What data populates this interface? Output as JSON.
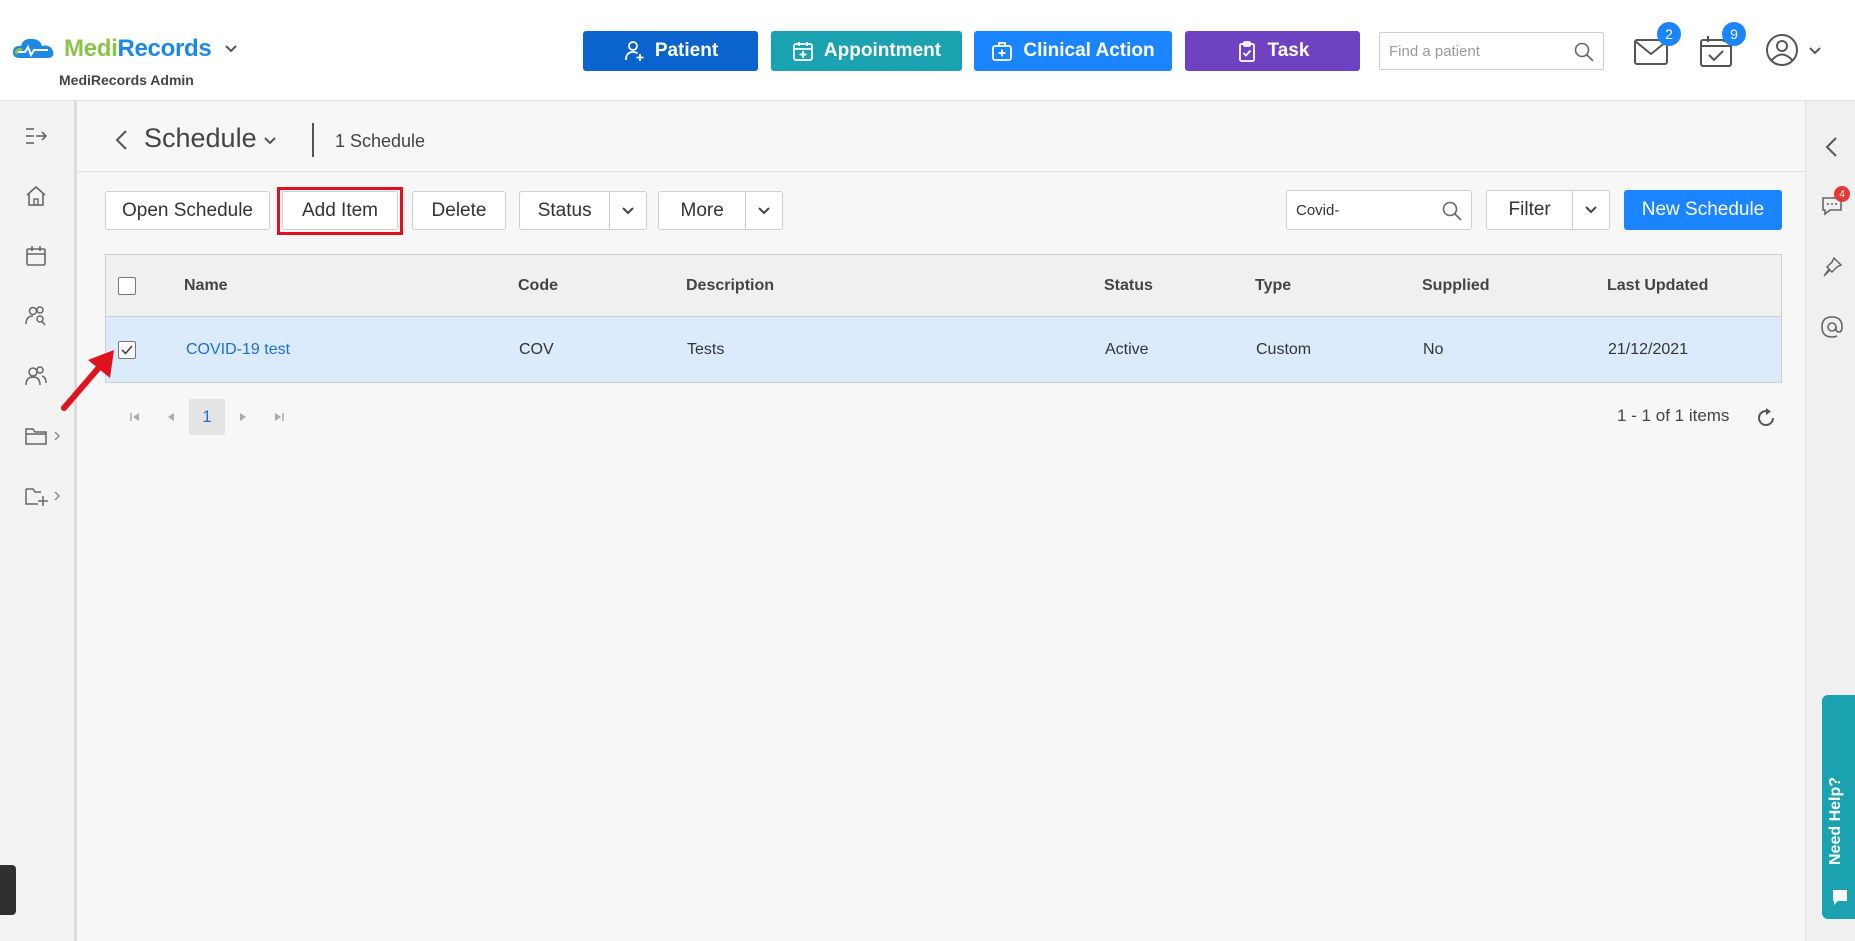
{
  "header": {
    "brand_part1": "Medi",
    "brand_part2": "Records",
    "brand_subtitle": "MediRecords Admin",
    "buttons": {
      "patient": "Patient",
      "appointment": "Appointment",
      "clinical_action": "Clinical Action",
      "task": "Task"
    },
    "search_placeholder": "Find a patient",
    "mail_badge": "2",
    "calendar_badge": "9"
  },
  "page": {
    "title": "Schedule",
    "subtitle": "1 Schedule"
  },
  "toolbar": {
    "open_schedule": "Open Schedule",
    "add_item": "Add Item",
    "delete": "Delete",
    "status": "Status",
    "more": "More",
    "search_value": "Covid-",
    "filter": "Filter",
    "new_schedule": "New Schedule"
  },
  "grid": {
    "columns": [
      "Name",
      "Code",
      "Description",
      "Status",
      "Type",
      "Supplied",
      "Last Updated"
    ],
    "rows": [
      {
        "name": "COVID-19 test",
        "code": "COV",
        "description": "Tests",
        "status": "Active",
        "type": "Custom",
        "supplied": "No",
        "last_updated": "21/12/2021",
        "checked": true
      }
    ]
  },
  "pagination": {
    "current_page": "1",
    "info": "1 - 1 of 1 items"
  },
  "right_sidebar": {
    "chat_badge": "4",
    "help_label": "Need Help?"
  },
  "colors": {
    "primary": "#1b84ff",
    "patient": "#0b63ce",
    "appointment": "#1aa2b0",
    "task": "#6f42c1",
    "highlight": "#e0121f",
    "selected_row": "#dcebfc"
  }
}
